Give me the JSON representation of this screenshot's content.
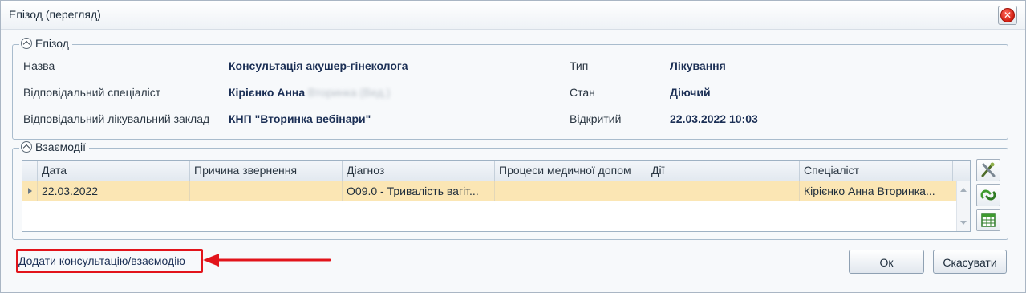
{
  "window": {
    "title": "Епізод (перегляд)",
    "close_glyph": "✕"
  },
  "episode_group": {
    "legend": "Епізод",
    "fields": {
      "name_label": "Назва",
      "name_value": "Консультація акушер-гінеколога",
      "specialist_label": "Відповідальний спеціаліст",
      "specialist_value": "Кірієнко Анна",
      "specialist_blurred": "Вторинка (Вед.)",
      "facility_label": "Відповідальний лікувальний заклад",
      "facility_value": "КНП \"Вторинка вебінари\"",
      "type_label": "Тип",
      "type_value": "Лікування",
      "state_label": "Стан",
      "state_value": "Діючий",
      "opened_label": "Відкритий",
      "opened_value": "22.03.2022 10:03"
    }
  },
  "interactions_group": {
    "legend": "Взаємодії",
    "columns": [
      "Дата",
      "Причина звернення",
      "Діагноз",
      "Процеси медичної допом",
      "Дії",
      "Спеціаліст"
    ],
    "rows": [
      {
        "date": "22.03.2022",
        "reason": "",
        "diagnosis": "O09.0 - Тривалість вагіт...",
        "processes": "",
        "actions": "",
        "specialist": "Кірієнко Анна Вторинка..."
      }
    ],
    "tools": [
      "edit-tools-icon",
      "refresh-link-icon",
      "spreadsheet-icon"
    ]
  },
  "footer": {
    "add_link": "Додати консультацію/взаємодію",
    "ok_label": "Ок",
    "cancel_label": "Скасувати"
  },
  "colors": {
    "highlight": "#e2141b",
    "selected_row": "#fbe6b4",
    "accent_text": "#1b2f55"
  }
}
